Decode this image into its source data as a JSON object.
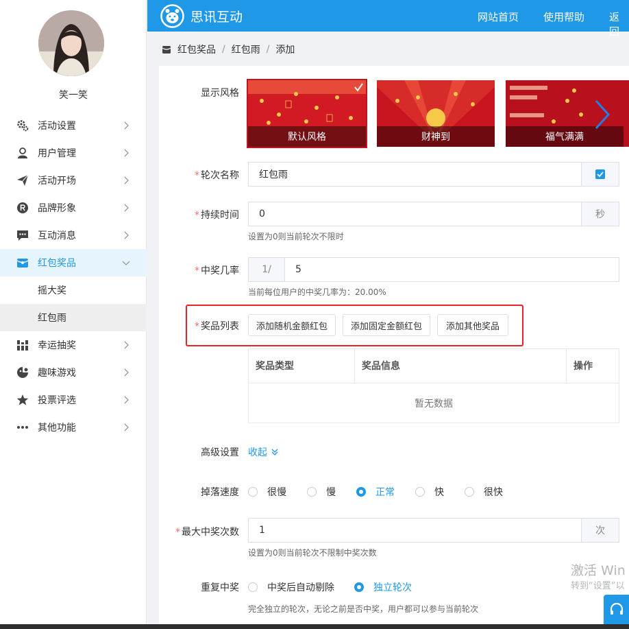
{
  "user": {
    "name": "笑一笑"
  },
  "sidebar": {
    "items": [
      {
        "label": "活动设置",
        "icon": "gear-icon"
      },
      {
        "label": "用户管理",
        "icon": "user-icon"
      },
      {
        "label": "活动开场",
        "icon": "send-icon"
      },
      {
        "label": "品牌形象",
        "icon": "registered-icon"
      },
      {
        "label": "互动消息",
        "icon": "message-icon"
      },
      {
        "label": "红包奖品",
        "icon": "gift-icon",
        "active": true
      },
      {
        "label": "幸运抽奖",
        "icon": "slot-icon"
      },
      {
        "label": "趣味游戏",
        "icon": "game-icon"
      },
      {
        "label": "投票评选",
        "icon": "star-icon"
      },
      {
        "label": "其他功能",
        "icon": "more-icon"
      }
    ],
    "sub_items": [
      {
        "label": "摇大奖"
      },
      {
        "label": "红包雨",
        "active": true
      }
    ]
  },
  "header": {
    "brand": "思讯互动",
    "nav": [
      "网站首页",
      "使用帮助",
      "返回"
    ]
  },
  "breadcrumb": [
    "红包奖品",
    "红包雨",
    "添加"
  ],
  "form": {
    "style": {
      "label": "显示风格",
      "options": [
        "默认风格",
        "财神到",
        "福气满满"
      ]
    },
    "round_name": {
      "label": "轮次名称",
      "value": "红包雨"
    },
    "duration": {
      "label": "持续时间",
      "value": "0",
      "unit": "秒",
      "hint": "设置为0则当前轮次不限时"
    },
    "rate": {
      "label": "中奖几率",
      "prefix": "1/",
      "value": "5",
      "hint": "当前每位用户的中奖几率为：20.00%"
    },
    "prizes": {
      "label": "奖品列表",
      "buttons": [
        "添加随机金额红包",
        "添加固定金额红包",
        "添加其他奖品"
      ],
      "columns": [
        "奖品类型",
        "奖品信息",
        "操作"
      ],
      "empty": "暂无数据"
    },
    "advanced": {
      "label": "高级设置",
      "toggle": "收起"
    },
    "speed": {
      "label": "掉落速度",
      "options": [
        "很慢",
        "慢",
        "正常",
        "快",
        "很快"
      ],
      "selected": "正常"
    },
    "max_wins": {
      "label": "最大中奖次数",
      "value": "1",
      "unit": "次",
      "hint": "设置为0则当前轮次不限制中奖次数"
    },
    "repeat": {
      "label": "重复中奖",
      "options": [
        "中奖后自动剔除",
        "独立轮次"
      ],
      "selected": "独立轮次",
      "hint": "完全独立的轮次，无论之前是否中奖，用户都可以参与当前轮次"
    }
  },
  "watermark": {
    "line1": "激活 Win",
    "line2": "转到“设置”以"
  },
  "colors": {
    "primary": "#1f98e8",
    "required": "#f56c6c",
    "highlight": "#e8222a"
  }
}
